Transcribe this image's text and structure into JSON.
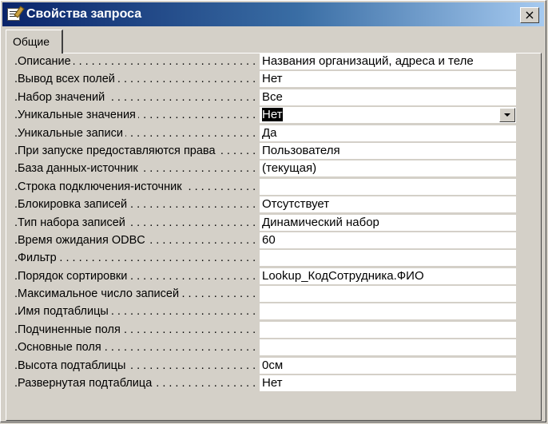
{
  "window": {
    "title": "Свойства запроса",
    "close_label": "×"
  },
  "tabs": [
    {
      "label": "Общие"
    }
  ],
  "properties": [
    {
      "label": "Описание",
      "value": "Названия организаций, адреса и теле"
    },
    {
      "label": "Вывод всех полей",
      "value": "Нет"
    },
    {
      "label": "Набор значений",
      "value": "Все"
    },
    {
      "label": "Уникальные значения",
      "value": "Нет"
    },
    {
      "label": "Уникальные записи",
      "value": "Да"
    },
    {
      "label": "При запуске предоставляются права",
      "value": "Пользователя"
    },
    {
      "label": "База данных-источник",
      "value": "(текущая)"
    },
    {
      "label": "Строка подключения-источник",
      "value": ""
    },
    {
      "label": "Блокировка записей",
      "value": "Отсутствует"
    },
    {
      "label": "Тип набора записей",
      "value": "Динамический набор"
    },
    {
      "label": "Время ожидания ODBC",
      "value": "60"
    },
    {
      "label": "Фильтр",
      "value": ""
    },
    {
      "label": "Порядок сортировки",
      "value": "Lookup_КодСотрудника.ФИО"
    },
    {
      "label": "Максимальное число записей",
      "value": ""
    },
    {
      "label": "Имя подтаблицы",
      "value": ""
    },
    {
      "label": "Подчиненные поля",
      "value": ""
    },
    {
      "label": "Основные поля",
      "value": ""
    },
    {
      "label": "Высота подтаблицы",
      "value": "0см"
    },
    {
      "label": "Развернутая подтаблица",
      "value": "Нет"
    }
  ]
}
